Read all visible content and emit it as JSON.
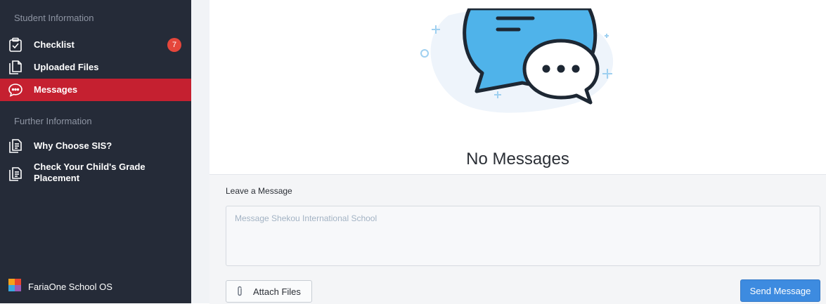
{
  "sidebar": {
    "section_student": "Student Information",
    "items": [
      {
        "label": "Checklist",
        "icon": "checklist-icon",
        "badge": "7"
      },
      {
        "label": "Uploaded Files",
        "icon": "files-icon"
      },
      {
        "label": "Messages",
        "icon": "messages-icon",
        "active": true
      }
    ],
    "section_further": "Further Information",
    "further_items": [
      {
        "label": "Why Choose SIS?",
        "icon": "document-icon"
      },
      {
        "label_line1": "Check Your Child's Grade",
        "label_line2": "Placement",
        "icon": "document-icon"
      }
    ],
    "footer_brand": "FariaOne School OS"
  },
  "main": {
    "empty_title": "No Messages",
    "compose": {
      "label": "Leave a Message",
      "placeholder": "Message Shekou International School",
      "value": "",
      "attach_label": "Attach Files",
      "send_label": "Send Message"
    }
  },
  "colors": {
    "sidebar_bg": "#252b38",
    "active_item": "#c52030",
    "badge": "#e5463b",
    "primary_button": "#3d8be0",
    "bubble_blue": "#4fb3ea"
  }
}
